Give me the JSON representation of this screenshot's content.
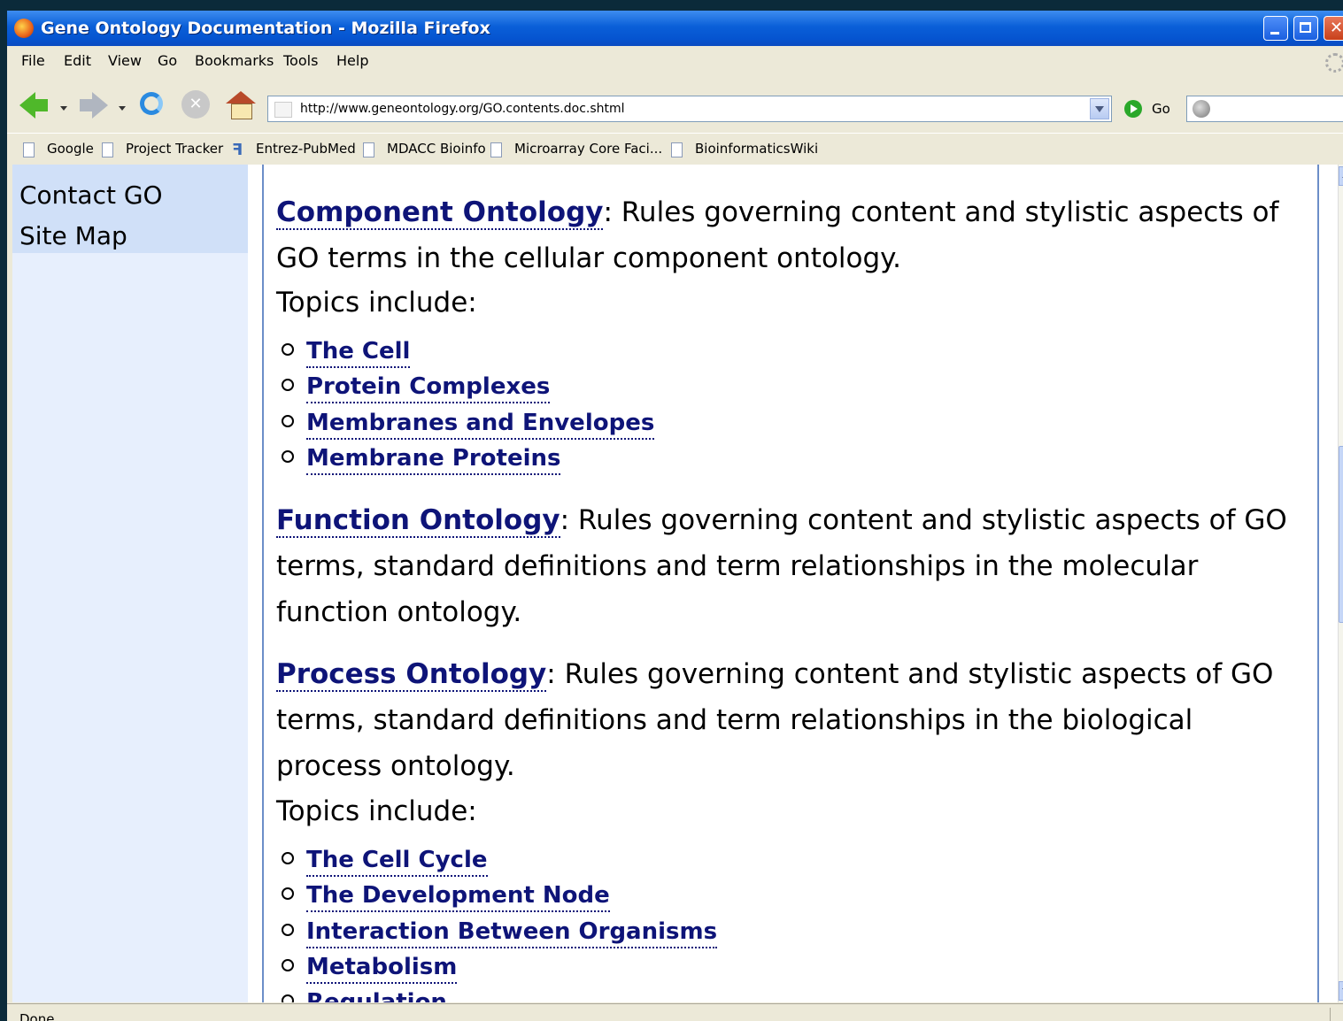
{
  "window": {
    "title": "Gene Ontology Documentation - Mozilla Firefox"
  },
  "menu": {
    "items": [
      "File",
      "Edit",
      "View",
      "Go",
      "Bookmarks",
      "Tools",
      "Help"
    ]
  },
  "toolbar": {
    "url": "http://www.geneontology.org/GO.contents.doc.shtml",
    "go_label": "Go"
  },
  "bookmarks": {
    "items": [
      "Google",
      "Project Tracker",
      "Entrez-PubMed",
      "MDACC Bioinfo",
      "Microarray Core Faci...",
      "BioinformaticsWiki"
    ]
  },
  "sidebar": {
    "links": [
      "Contact GO",
      "Site Map"
    ]
  },
  "content": {
    "component": {
      "link": "Component Ontology",
      "text": ": Rules governing content and stylistic aspects of GO terms in the cellular component ontology.",
      "topics_intro": "Topics include:",
      "topics": [
        "The Cell",
        "Protein Complexes",
        "Membranes and Envelopes",
        "Membrane Proteins"
      ]
    },
    "function": {
      "link": "Function Ontology",
      "text": ": Rules governing content and stylistic aspects of GO terms, standard definitions and term relationships in the molecular function ontology."
    },
    "process": {
      "link": "Process Ontology",
      "text": ": Rules governing content and stylistic aspects of GO terms, standard definitions and term relationships in the biological process ontology.",
      "topics_intro": "Topics include:",
      "topics": [
        "The Cell Cycle",
        "The Development Node",
        "Interaction Between Organisms",
        "Metabolism",
        "Regulation"
      ]
    }
  },
  "status": {
    "text": "Done"
  }
}
